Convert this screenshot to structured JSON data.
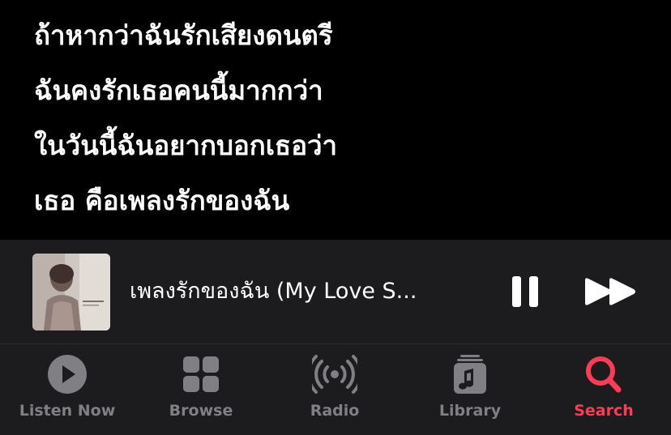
{
  "lyrics": {
    "lines": [
      "ถ้าหากว่าฉันรักเสียงดนตรี",
      "ฉันคงรักเธอคนนี้มากกว่า",
      "ในวันนี้ฉันอยากบอกเธอว่า",
      "เธอ คือเพลงรักของฉัน"
    ]
  },
  "player": {
    "song_title": "เพลงรักของฉัน (My Love S...",
    "artwork_icon": "album-artwork",
    "pause_icon": "pause-icon",
    "next_icon": "forward-icon",
    "state": "playing"
  },
  "tabs": [
    {
      "label": "Listen Now",
      "icon": "play-circle-icon",
      "active": false
    },
    {
      "label": "Browse",
      "icon": "grid-icon",
      "active": false
    },
    {
      "label": "Radio",
      "icon": "radio-broadcast-icon",
      "active": false
    },
    {
      "label": "Library",
      "icon": "music-library-icon",
      "active": false
    },
    {
      "label": "Search",
      "icon": "search-icon",
      "active": true
    }
  ],
  "colors": {
    "background": "#000000",
    "bar_background": "#1c1c1e",
    "inactive_tab": "#7f7f84",
    "accent": "#fa3c55",
    "text": "#ffffff"
  }
}
